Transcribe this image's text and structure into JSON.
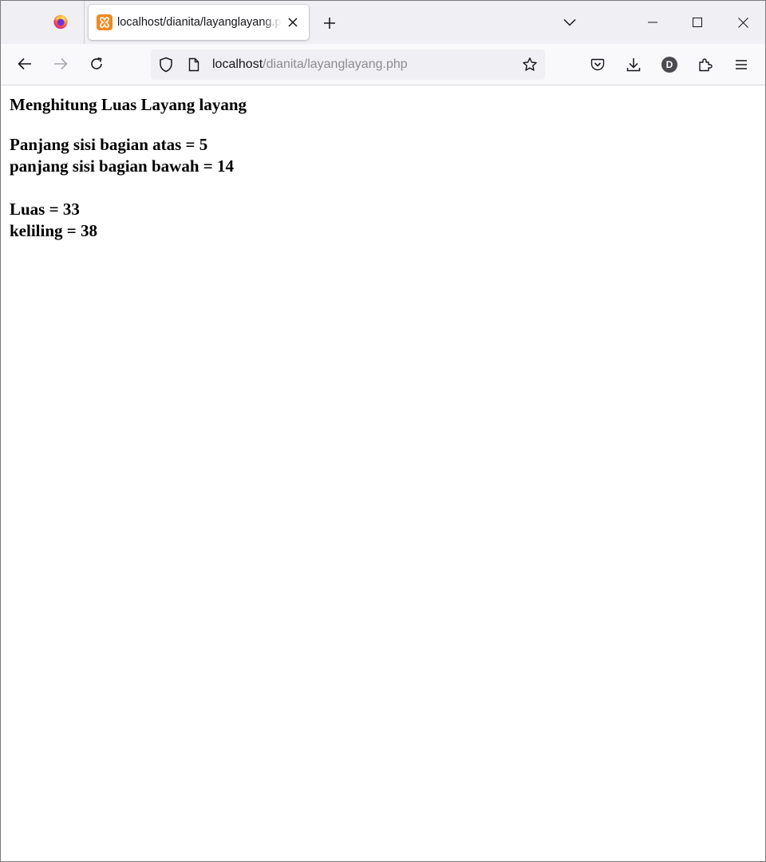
{
  "colors": {
    "tabstrip_bg": "#f0f0f4",
    "navbar_bg": "#f9f9fb",
    "urlbar_bg": "#f0f0f4",
    "favicon_accent": "#f08a24",
    "url_path_color": "#8b8b93",
    "icon_color": "#15141a"
  },
  "browser": {
    "firefox_icon": "firefox-logo-icon",
    "tab": {
      "title": "localhost/dianita/layanglayang.php",
      "favicon": "xampp-favicon-icon"
    },
    "new_tab_icon": "plus-icon",
    "tab_list_icon": "chevron-down-icon",
    "window_controls": [
      "minimize-icon",
      "maximize-icon",
      "close-icon"
    ],
    "nav": {
      "back_icon": "arrow-left-icon",
      "forward_icon": "arrow-right-icon",
      "reload_icon": "reload-icon"
    },
    "url": {
      "host": "localhost",
      "path": "/dianita/layanglayang.php"
    },
    "toolbar_icons": [
      "pocket-icon",
      "download-icon",
      "account-icon",
      "extensions-icon",
      "menu-icon"
    ],
    "account_initial": "D"
  },
  "page": {
    "heading": "Menghitung Luas Layang layang",
    "lines": [
      "Panjang sisi bagian atas = 5",
      "panjang sisi bagian bawah = 14",
      "Luas = 33",
      "keliling = 38"
    ]
  }
}
